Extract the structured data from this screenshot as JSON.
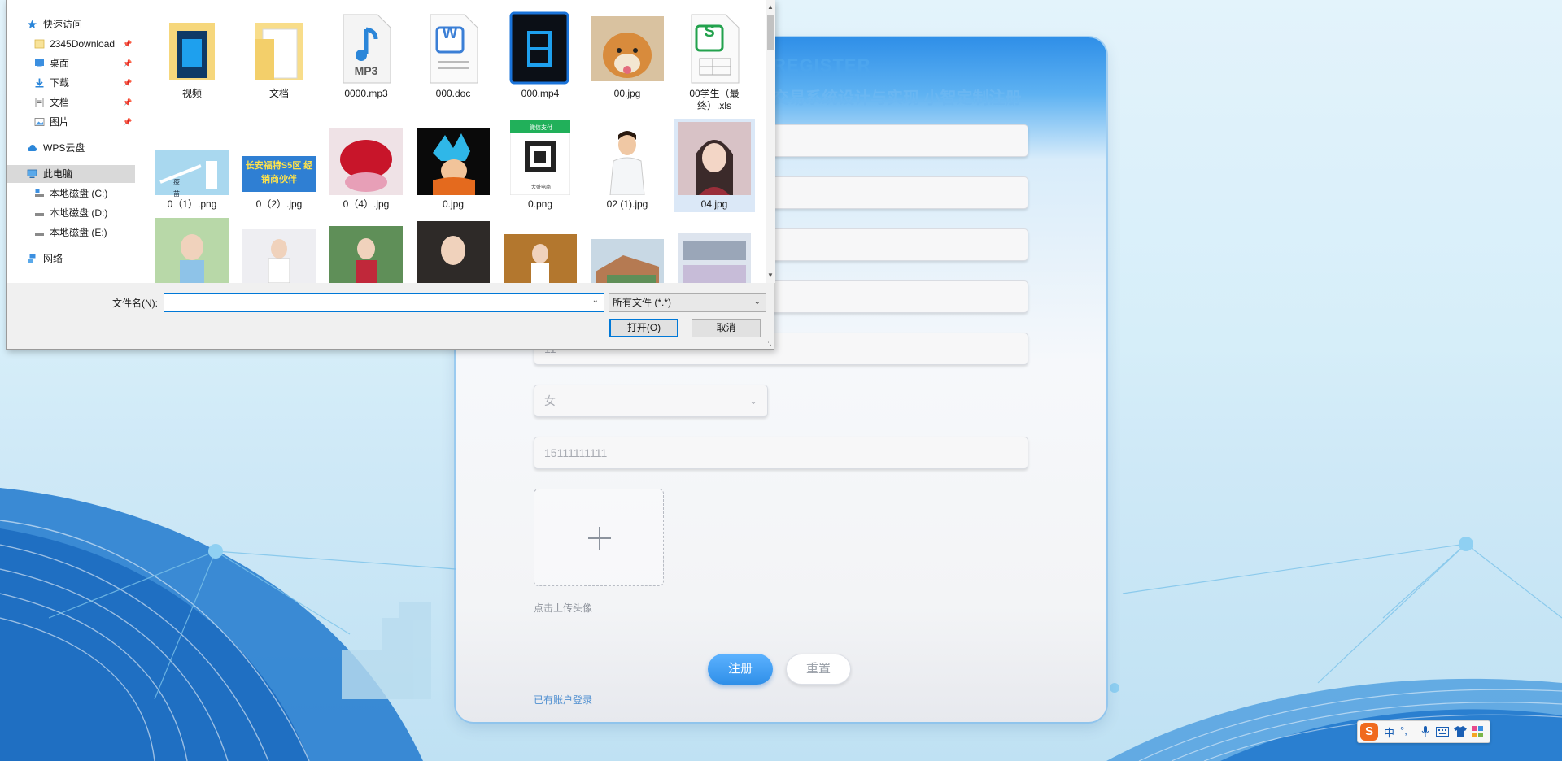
{
  "register_card": {
    "title": "REGISTER",
    "subtitle": "交易系统设计与实现 小智定制注册",
    "fields": [
      {
        "value": ""
      },
      {
        "value": ""
      },
      {
        "value": ""
      },
      {
        "value": ""
      },
      {
        "value": "11"
      }
    ],
    "gender_select": {
      "value": "女"
    },
    "phone_field": {
      "value": "15111111111"
    },
    "upload_hint": "点击上传头像",
    "register_button": "注册",
    "reset_button": "重置",
    "login_link": "已有账户登录"
  },
  "file_dialog": {
    "nav": [
      {
        "label": "快速访问",
        "icon": "star-icon"
      },
      {
        "label": "2345Download",
        "icon": "folder-icon",
        "pinned": true
      },
      {
        "label": "桌面",
        "icon": "desktop-icon",
        "pinned": true
      },
      {
        "label": "下载",
        "icon": "download-icon",
        "pinned": true
      },
      {
        "label": "文档",
        "icon": "document-icon",
        "pinned": true
      },
      {
        "label": "图片",
        "icon": "picture-icon",
        "pinned": true
      },
      {
        "label": "WPS云盘",
        "icon": "cloud-icon"
      },
      {
        "label": "此电脑",
        "icon": "computer-icon",
        "selected": true
      },
      {
        "label": "本地磁盘 (C:)",
        "icon": "drive-icon"
      },
      {
        "label": "本地磁盘 (D:)",
        "icon": "drive-icon"
      },
      {
        "label": "本地磁盘 (E:)",
        "icon": "drive-icon"
      },
      {
        "label": "网络",
        "icon": "network-icon"
      }
    ],
    "files_row1": [
      {
        "label": "视频",
        "kind": "video-folder"
      },
      {
        "label": "文档",
        "kind": "folder"
      },
      {
        "label": "0000.mp3",
        "kind": "mp3",
        "badge": "MP3"
      },
      {
        "label": "000.doc",
        "kind": "doc",
        "badge": "W"
      },
      {
        "label": "000.mp4",
        "kind": "mp4"
      },
      {
        "label": "00.jpg",
        "kind": "photo-dog"
      },
      {
        "label": "00学生（最终）.xls",
        "kind": "xls",
        "badge": "S"
      }
    ],
    "files_row2": [
      {
        "label": "0（1）.png",
        "kind": "photo-vial",
        "thumb_text": "疫苗"
      },
      {
        "label": "0（2）.jpg",
        "kind": "photo-banner",
        "thumb_text": "长安福特S5区 经销商伙伴"
      },
      {
        "label": "0（4）.jpg",
        "kind": "photo-roses"
      },
      {
        "label": "0.jpg",
        "kind": "photo-anime"
      },
      {
        "label": "0.png",
        "kind": "photo-qr",
        "thumb_text": "微信支付",
        "thumb_caption": "大盛电商"
      },
      {
        "label": "02 (1).jpg",
        "kind": "photo-doctor"
      },
      {
        "label": "04.jpg",
        "kind": "photo-girl",
        "selected": true
      }
    ],
    "files_row3": [
      {
        "kind": "photo-p1"
      },
      {
        "kind": "photo-p2"
      },
      {
        "kind": "photo-p3"
      },
      {
        "kind": "photo-p4"
      },
      {
        "kind": "photo-p5"
      },
      {
        "kind": "photo-p6"
      },
      {
        "kind": "photo-p7"
      }
    ],
    "filename_label": "文件名(N):",
    "filename_value": "",
    "filetype_value": "所有文件 (*.*)",
    "open_button": "打开(O)",
    "cancel_button": "取消"
  },
  "ime_toolbar": {
    "logo": "S",
    "items": [
      "中",
      "°,",
      "mic-icon",
      "keyboard-icon",
      "shirt-icon",
      "grid-icon"
    ]
  },
  "colors": {
    "accent": "#2f8fe8",
    "dialog_select": "#0078d7"
  }
}
